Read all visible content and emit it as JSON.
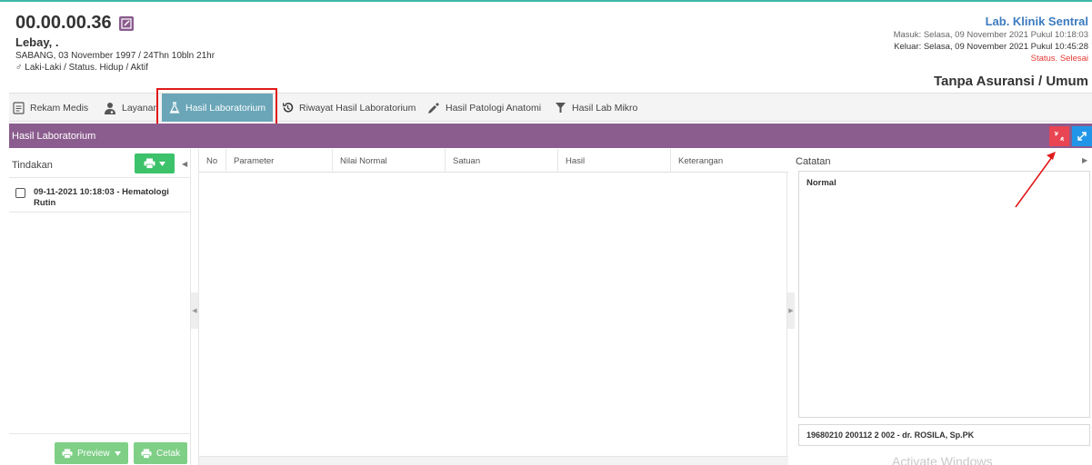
{
  "patient": {
    "id": "00.00.00.36",
    "name": "Lebay, .",
    "birth": "SABANG, 03 November 1997 / 24Thn 10bln 21hr",
    "gender_status": "♂ Laki-Laki / Status. Hidup / Aktif"
  },
  "visit": {
    "unit": "Lab. Klinik Sentral",
    "masuk": "Masuk: Selasa, 09 November 2021 Pukul 10:18:03",
    "keluar": "Keluar: Selasa, 09 November 2021 Pukul 10:45:28",
    "status": "Status. Selesai",
    "insurance": "Tanpa Asuransi / Umum"
  },
  "tabs": [
    {
      "label": "Rekam Medis",
      "icon": "document-icon"
    },
    {
      "label": "Layanan",
      "icon": "doctor-icon"
    },
    {
      "label": "Hasil Laboratorium",
      "icon": "flask-icon",
      "active": true
    },
    {
      "label": "Riwayat Hasil Laboratorium",
      "icon": "history-icon"
    },
    {
      "label": "Hasil Patologi Anatomi",
      "icon": "dropper-icon"
    },
    {
      "label": "Hasil Lab Mikro",
      "icon": "funnel-icon"
    }
  ],
  "panel": {
    "title": "Hasil Laboratorium"
  },
  "left": {
    "title": "Tindakan",
    "items": [
      {
        "label": "09-11-2021 10:18:03 - Hematologi Rutin",
        "checked": false
      }
    ],
    "preview_label": "Preview",
    "cetak_label": "Cetak"
  },
  "table": {
    "columns": [
      "No",
      "Parameter",
      "Nilai Normal",
      "Satuan",
      "Hasil",
      "Keterangan"
    ],
    "rows": []
  },
  "right": {
    "title": "Catatan",
    "notes": "Normal",
    "signer": "19680210 200112 2 002 - dr. ROSILA, Sp.PK"
  },
  "watermark": "Activate Windows",
  "colors": {
    "header_purple": "#8b5c8e",
    "tab_active": "#6aa6b8",
    "green_button": "#3cc26a",
    "red_button": "#e94552",
    "blue_button": "#2196e8",
    "highlight": "#e01a1a"
  }
}
